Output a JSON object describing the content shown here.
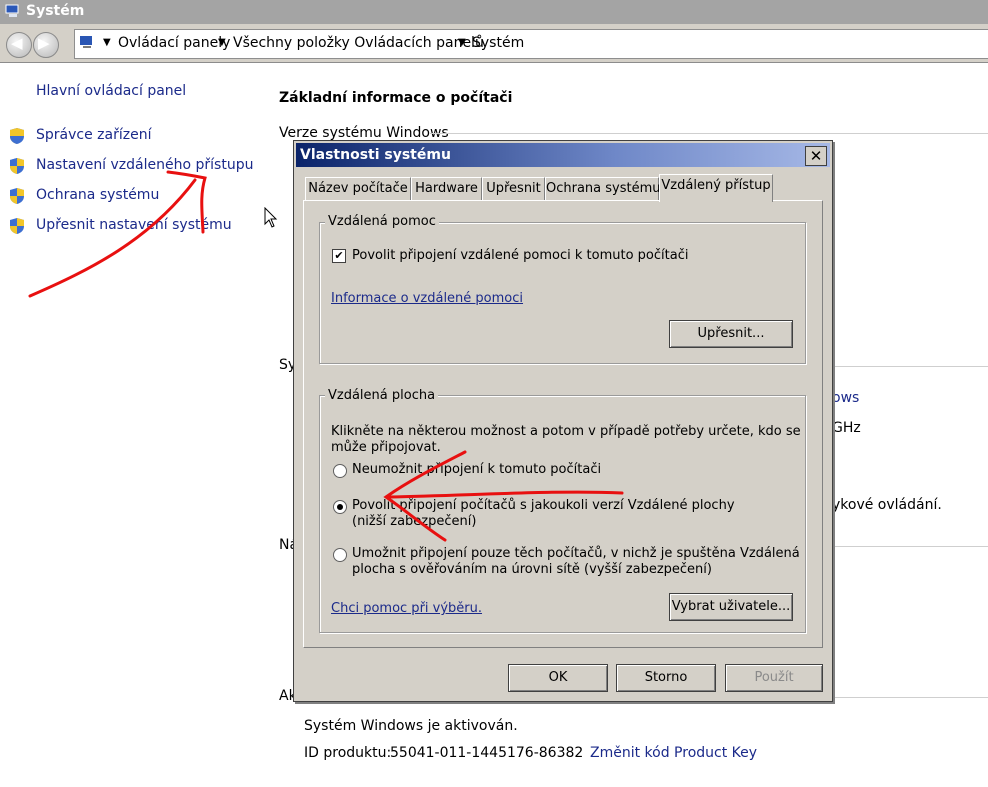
{
  "window": {
    "title": "Systém"
  },
  "address": {
    "crumbs": [
      "Ovládací panely",
      "Všechny položky Ovládacích panelů",
      "Systém"
    ]
  },
  "left_pane": {
    "home": "Hlavní ovládací panel",
    "items": [
      "Správce zařízení",
      "Nastavení vzdáleného přístupu",
      "Ochrana systému",
      "Upřesnit nastavení systému"
    ]
  },
  "main": {
    "heading": "Základní informace o počítači",
    "windows_edition": "Verze systému Windows",
    "frag_sy": "Sy",
    "frag_na": "Ná",
    "frag_ak": "Ak",
    "frag_ows": "ows",
    "frag_ghz": "GHz",
    "frag_touch": "ykové ovládání.",
    "activation_status": "Systém Windows je aktivován.",
    "product_id_label": "ID produktu:",
    "product_id_value": "55041-011-1445176-86382",
    "change_key": "Změnit kód Product Key"
  },
  "dialog": {
    "title": "Vlastnosti systému",
    "close_symbol": "✕",
    "tabs": [
      "Název počítače",
      "Hardware",
      "Upřesnit",
      "Ochrana systému",
      "Vzdálený přístup"
    ],
    "assistance": {
      "group_label": "Vzdálená pomoc",
      "checkbox_label": "Povolit připojení vzdálené pomoci k tomuto počítači",
      "checked_mark": "✔",
      "info_link": "Informace o vzdálené pomoci",
      "advanced_button": "Upřesnit..."
    },
    "desktop": {
      "group_label": "Vzdálená plocha",
      "instructions_line1": "Klikněte na některou možnost a potom v případě potřeby určete, kdo se",
      "instructions_line2": "může připojovat.",
      "option1": "Neumožnit připojení k tomuto počítači",
      "option2_line1": "Povolit připojení počítačů s jakoukoli verzí Vzdálené plochy",
      "option2_line2": "(nižší zabezpečení)",
      "option3_line1": "Umožnit připojení pouze těch počítačů, v nichž je spuštěna Vzdálená",
      "option3_line2": "plocha s ověřováním na úrovni sítě (vyšší zabezpečení)",
      "selected_option": 2,
      "help_link": "Chci pomoc při výběru.",
      "select_users_button": "Vybrat uživatele..."
    },
    "buttons": {
      "ok": "OK",
      "cancel": "Storno",
      "apply": "Použít"
    }
  },
  "colors": {
    "link": "#1b2a8a",
    "annotation": "#e81010",
    "dialog_bg": "#d4d0c8"
  }
}
